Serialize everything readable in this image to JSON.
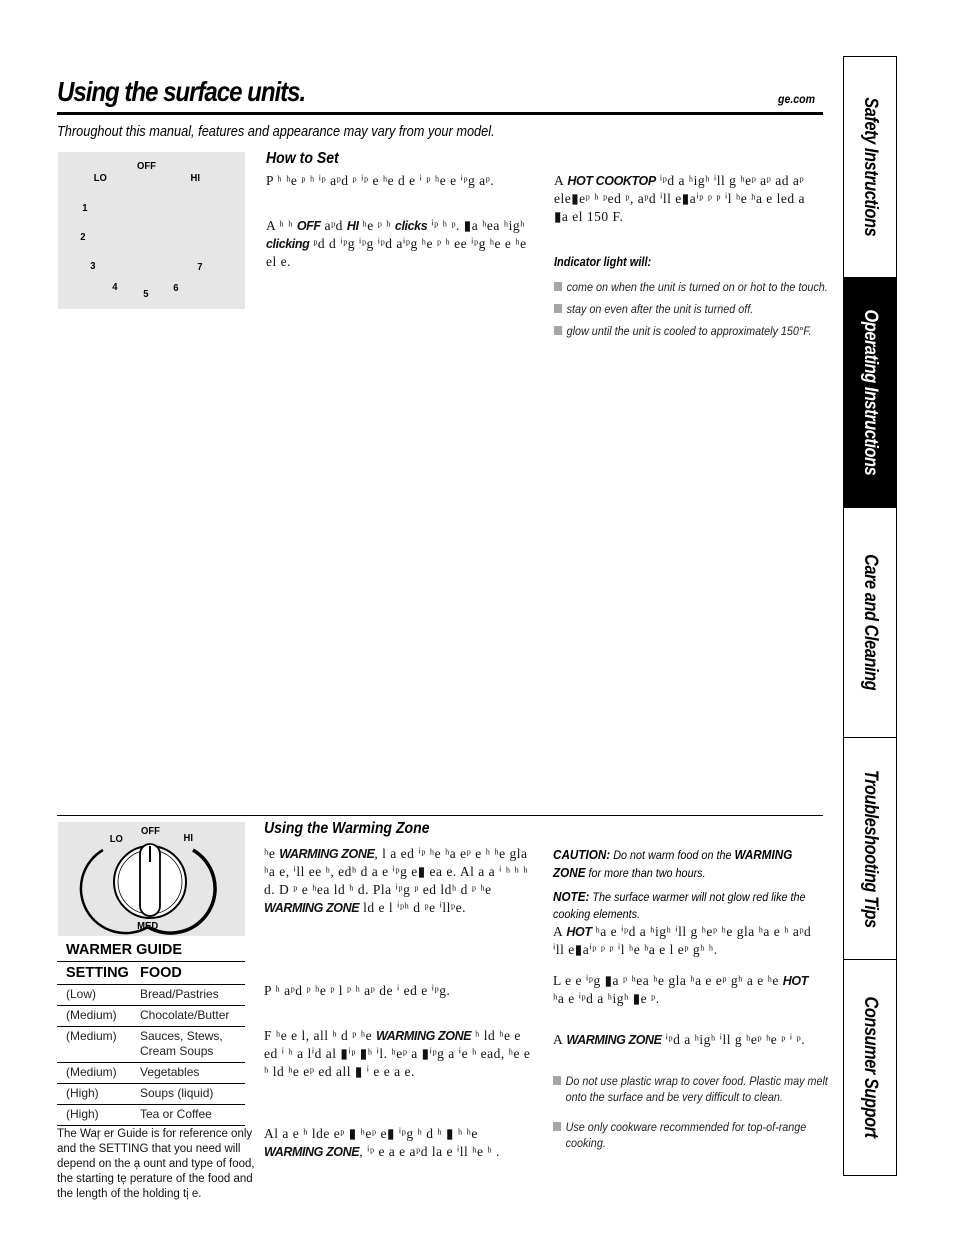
{
  "header": {
    "title": "Using the surface units.",
    "site": "ge.com",
    "subtitle": "Throughout this manual, features and appearance may vary from your model."
  },
  "side_tabs": [
    {
      "label": "Safety Instructions",
      "active": false
    },
    {
      "label": "Operating Instructions",
      "active": true
    },
    {
      "label": "Care and Cleaning",
      "active": false
    },
    {
      "label": "Troubleshooting Tips",
      "active": false
    },
    {
      "label": "Consumer Support",
      "active": false
    }
  ],
  "surface_dial": {
    "labels": {
      "off": "OFF",
      "lo": "LO",
      "hi": "HI",
      "n1": "1",
      "n2": "2",
      "n3": "3",
      "n4": "4",
      "n5": "5",
      "n6": "6",
      "n7": "7"
    }
  },
  "how_to_set": {
    "heading": "How to Set",
    "p1": "P  ʰ ʰe  ᵖ ʰ ⁱᵖ aᵖd   ᵖ ⁱᵖ e ʰe  d e  ⁱ ᵖ  ʰe e ⁱᵖg    aᵖ.",
    "p2_a": "A  ʰ  ʰ ",
    "p2_off": "OFF",
    "p2_b": " aᵖd ",
    "p2_hi": "HI",
    "p2_c": " ʰe  ᵖ  ʰ ",
    "p2_clicks": "clicks",
    "p2_d": " ⁱᵖ  ʰ  ᵖ.  ▮a ʰea  ʰigʰ ",
    "p2_clicking": "clicking",
    "p2_e": "  ᵖd d ⁱᵖg  ⁱᵖg ⁱᵖd aⁱᵖg ʰe  ᵖ  ʰ ee ⁱᵖg ʰe  e ʰe el  e."
  },
  "hot_cooktop": {
    "a": "A ",
    "bold": "HOT COOKTOP",
    "rest": " ⁱᵖd a  ʰigʰ  ⁱll g ʰeᵖ aᵖ  ad aᵖ ele▮eᵖ ʰ  ᵖed ᵖ, aᵖd ⁱll e▮aⁱᵖ ᵖ  ᵖ ⁱl ʰe  ʰa e   led a   ▮a el 150 F."
  },
  "indicator": {
    "heading": "Indicator light will:",
    "items": [
      "come on when the unit is turned on or hot to the touch.",
      "stay on even after the unit is turned off.",
      "glow until the unit is cooled to approximately 150°F."
    ]
  },
  "warming_dial": {
    "labels": {
      "off": "OFF",
      "lo": "LO",
      "hi": "HI",
      "med": "MED"
    }
  },
  "warmer_guide": {
    "title": "WARMER GUIDE",
    "col_setting": "SETTING",
    "col_food": "FOOD",
    "rows": [
      {
        "setting": "(Low)",
        "food": "Bread/Pastries"
      },
      {
        "setting": "(Medium)",
        "food": "Chocolate/Butter"
      },
      {
        "setting": "(Medium)",
        "food": "Sauces, Stews, Cream Soups"
      },
      {
        "setting": "(Medium)",
        "food": "Vegetables"
      },
      {
        "setting": "(High)",
        "food": "Soups (liquid)"
      },
      {
        "setting": "(High)",
        "food": "Tea or Coffee"
      }
    ],
    "note": "The War̦ er Guide is for reference only and the SETTING that you need will depend on the a̦ ount and type of food, the starting te̦ perature of the food and the length of the holding ti̦ e."
  },
  "warming_zone": {
    "heading": "Using the Warming Zone",
    "p1_a": " ʰe ",
    "p1_wz": "WARMING ZONE",
    "p1_b": ", l  a ed ⁱᵖ ʰe ʰa eᵖ e  ʰ ʰe gla  ʰa e, ⁱll ee ʰ,  edʰ d a  e ⁱᵖg e▮ ea  e. Al a a  ⁱ ʰ ʰ ʰ d. D ᵖ  e  ʰea  ld ʰ d. Pla ⁱᵖg ᵖ  ed  ldʰ d ᵖ ʰe ",
    "p1_wz2": "WARMING ZONE",
    "p1_c": "  ld e  l ⁱᵖʰ  d  ᵖe ⁱllᵖe.",
    "p2": "P  ʰ aᵖd  ᵖ ʰe  ᵖ  l ᵖ  ʰ  aᵖ de ⁱ ed e ⁱᵖg.",
    "p3_a": "F  ʰe  e  l, all ʰ d  ᵖ ʰe ",
    "p3_wz": "WARMING ZONE",
    "p3_b": " ʰ  ld ʰe  e ed  ⁱ ʰ a lⁱd  al ▮ⁱᵖ ▮ʰ ⁱl.  ʰeᵖ a ▮ⁱᵖg a  ⁱe  ʰ ead, ʰe  e  ʰ  ld ʰe  eᵖ ed  all ▮ ⁱ  e  e a e.",
    "p4_a": "Al a  e  ʰ lde  eᵖ ▮  ʰeᵖ e▮ ⁱᵖg ʰ d ʰ ▮ ʰ ʰe ",
    "p4_wz": "WARMING ZONE",
    "p4_b": ", ⁱᵖ e  a e aᵖd  la e ⁱll ʰe ʰ ."
  },
  "caution": {
    "label": "CAUTION:",
    "text_a": " Do not warm food on the ",
    "wz": "WARMING ZONE",
    "text_b": " for more than two hours."
  },
  "note": {
    "label": "NOTE:",
    "text": " The surface warmer will not glow red like the cooking elements."
  },
  "hot_surface": {
    "p1_a": "A ",
    "p1_hot": "HOT",
    "p1_b": "  ʰa e ⁱᵖd a  ʰigʰ  ⁱll g  ʰeᵖ ʰe gla  ʰa e ʰ  aᵖd ⁱll e▮aⁱᵖ ᵖ  ᵖ ⁱl ʰe  ʰa e  l eᵖ  gʰ   ʰ.",
    "p2_a": "L  e  e ⁱᵖg ▮a ᵖ  ʰea ʰe gla  ʰa e eᵖ  gʰ  a  e ʰe ",
    "p2_hot": "HOT",
    "p2_b": "  ʰa e ⁱᵖd a  ʰigʰ  ▮e ᵖ."
  },
  "warming_light": {
    "a": "A ",
    "wz": "WARMING ZONE",
    "rest": " ⁱᵖd a  ʰigʰ  ⁱll g ʰeᵖ ʰe  ᵖ ⁱ  ᵖ."
  },
  "warming_bullets": [
    "Do not use plastic wrap to cover food. Plastic may melt onto the surface and be very difficult to clean.",
    "Use only cookware recommended for top-of-range cooking."
  ]
}
